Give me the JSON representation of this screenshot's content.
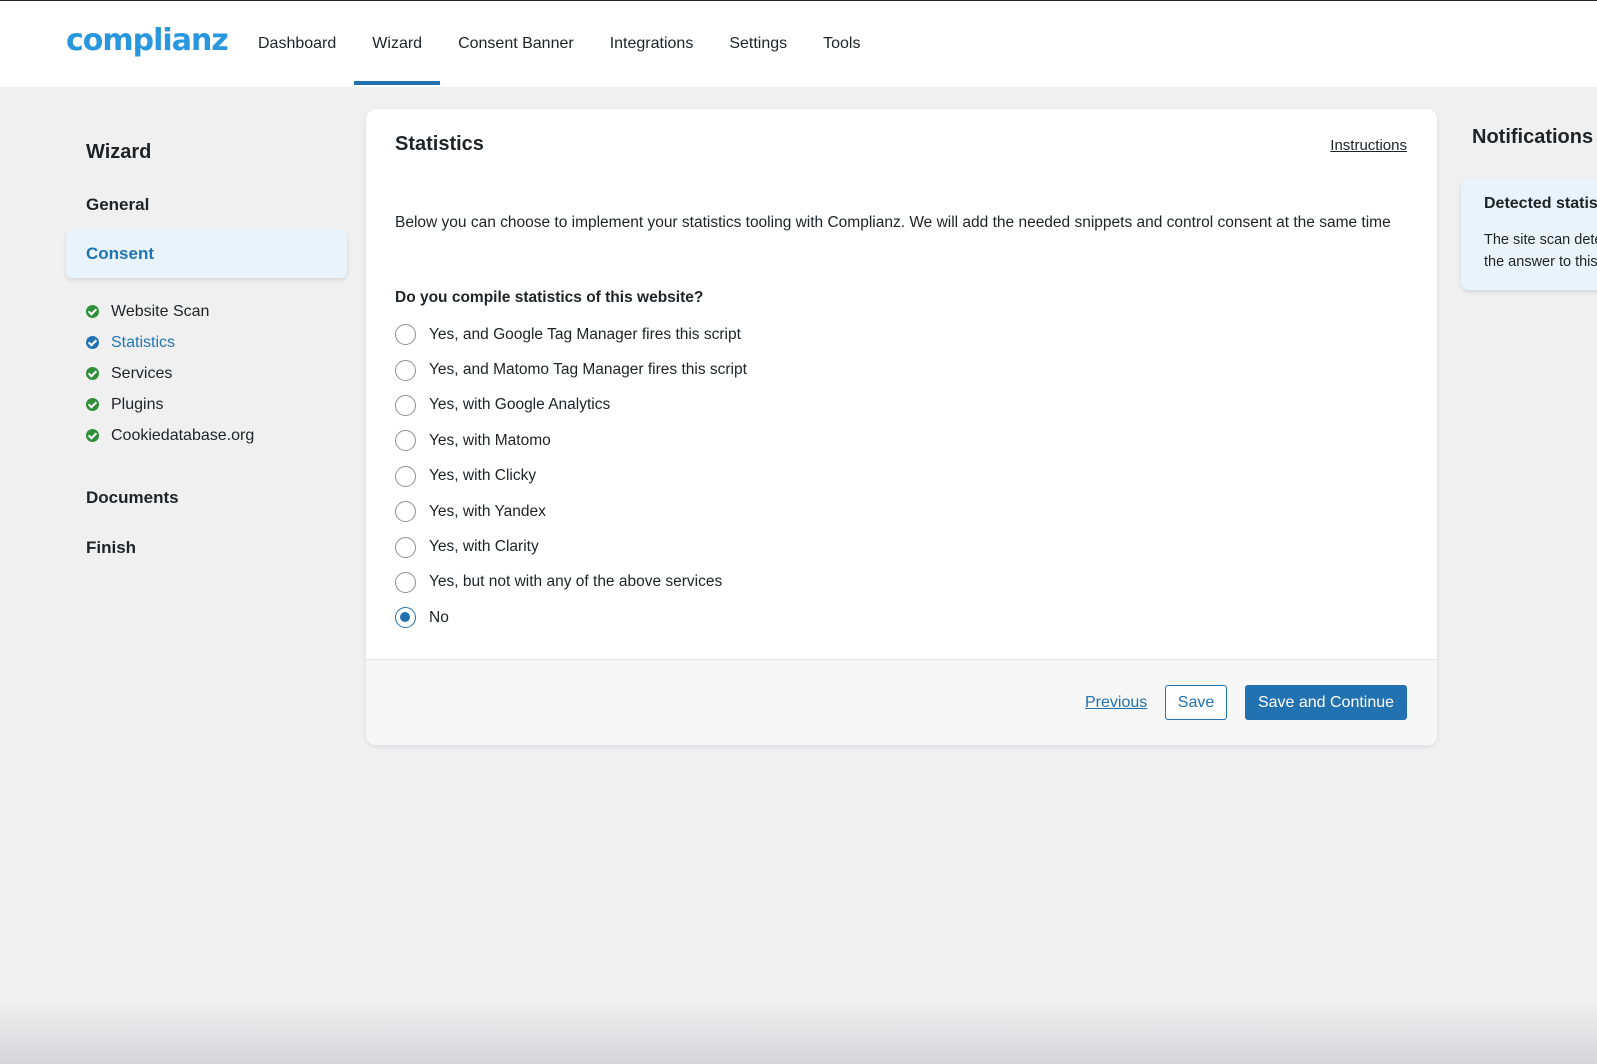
{
  "brand": {
    "logo": "complianz"
  },
  "nav": {
    "items": [
      {
        "label": "Dashboard",
        "active": false
      },
      {
        "label": "Wizard",
        "active": true
      },
      {
        "label": "Consent Banner",
        "active": false
      },
      {
        "label": "Integrations",
        "active": false
      },
      {
        "label": "Settings",
        "active": false
      },
      {
        "label": "Tools",
        "active": false
      }
    ]
  },
  "sidebar": {
    "title": "Wizard",
    "sections": {
      "general": "General",
      "consent": "Consent",
      "documents": "Documents",
      "finish": "Finish"
    },
    "steps": [
      {
        "label": "Website Scan",
        "status": "complete"
      },
      {
        "label": "Statistics",
        "status": "current"
      },
      {
        "label": "Services",
        "status": "complete"
      },
      {
        "label": "Plugins",
        "status": "complete"
      },
      {
        "label": "Cookiedatabase.org",
        "status": "complete"
      }
    ]
  },
  "main": {
    "title": "Statistics",
    "instructions": "Instructions",
    "intro": "Below you can choose to implement your statistics tooling with Complianz. We will add the needed snippets and control consent at the same time",
    "question": "Do you compile statistics of this website?",
    "options": [
      "Yes, and Google Tag Manager fires this script",
      "Yes, and Matomo Tag Manager fires this script",
      "Yes, with Google Analytics",
      "Yes, with Matomo",
      "Yes, with Clicky",
      "Yes, with Yandex",
      "Yes, with Clarity",
      "Yes, but not with any of the above services",
      "No"
    ],
    "selected": "No",
    "footer": {
      "previous": "Previous",
      "save": "Save",
      "save_continue": "Save and Continue"
    }
  },
  "notifications": {
    "title": "Notifications",
    "card_title": "Detected statistics",
    "card_body_1": "The site scan detected",
    "card_body_2": "the answer to this"
  },
  "colors": {
    "accent": "#2271b1",
    "logo": "#2897de",
    "complete": "#2f8f3a",
    "active_bg": "#e9f3fb",
    "background": "#f0f0f1"
  }
}
